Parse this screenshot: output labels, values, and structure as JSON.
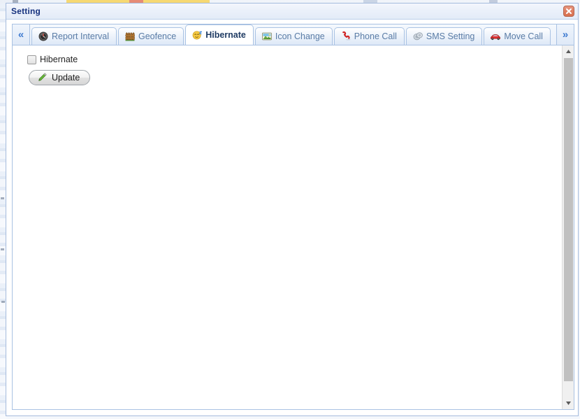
{
  "window": {
    "title": "Setting",
    "close_label": "x",
    "close_icon": "close-icon"
  },
  "tabbar": {
    "prev_arrow": "«",
    "next_arrow": "»",
    "tabs": [
      {
        "label": "Report Interval",
        "icon": "clock-icon",
        "active": false
      },
      {
        "label": "Geofence",
        "icon": "fence-icon",
        "active": false
      },
      {
        "label": "Hibernate",
        "icon": "sleep-face-icon",
        "active": true
      },
      {
        "label": "Icon Change",
        "icon": "picture-icon",
        "active": false
      },
      {
        "label": "Phone Call",
        "icon": "phone-icon",
        "active": false
      },
      {
        "label": "SMS Setting",
        "icon": "sms-disc-icon",
        "active": false
      },
      {
        "label": "Move Call",
        "icon": "car-icon",
        "active": false
      }
    ]
  },
  "content": {
    "hibernate_checkbox_label": "Hibernate",
    "hibernate_checked": false,
    "update_button_label": "Update",
    "update_button_icon": "pencil-icon"
  },
  "scrollbar": {
    "up_arrow": "▲",
    "down_arrow": "▼"
  },
  "colors": {
    "title_text": "#15317e",
    "frame_border": "#a5bbdd",
    "tab_border": "#a9c2e3",
    "active_tab_text": "#1f3b63",
    "inactive_tab_text": "#5a7ca6",
    "close_button": "#d8714f",
    "accent_blue": "#3f7bd0"
  }
}
